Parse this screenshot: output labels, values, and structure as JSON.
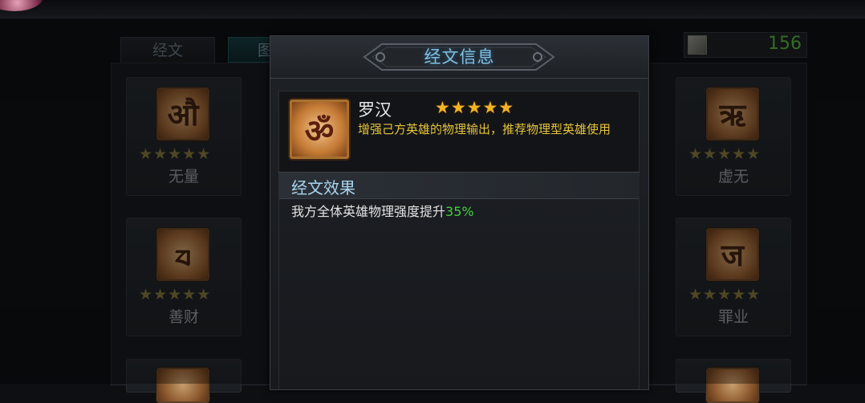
{
  "tabs": [
    {
      "label": "经文"
    },
    {
      "label": "图"
    }
  ],
  "currency": {
    "value": "156"
  },
  "left_cards": [
    {
      "name": "无量",
      "stars": "★★★★★",
      "glyph": "औ"
    },
    {
      "name": "善财",
      "stars": "★★★★★",
      "glyph": "ᤔ"
    }
  ],
  "right_cards": [
    {
      "name": "虚无",
      "stars": "★★★★★",
      "glyph": "ऋ"
    },
    {
      "name": "罪业",
      "stars": "★★★★★",
      "glyph": "ज"
    }
  ],
  "modal": {
    "title": "经文信息",
    "hero": {
      "name": "罗汉",
      "stars": "★★★★★",
      "rating": 5,
      "description": "增强己方英雄的物理输出，推荐物理型英雄使用",
      "glyph": "ॐ"
    },
    "effect": {
      "title": "经文效果",
      "text": "我方全体英雄物理强度提升",
      "value": "35%"
    }
  },
  "colors": {
    "title_blue": "#7fc0e3",
    "star_gold": "#f2b424",
    "desc_yellow": "#e6c43a",
    "effect_green": "#3fd33c",
    "counter_green": "#4fa638"
  }
}
